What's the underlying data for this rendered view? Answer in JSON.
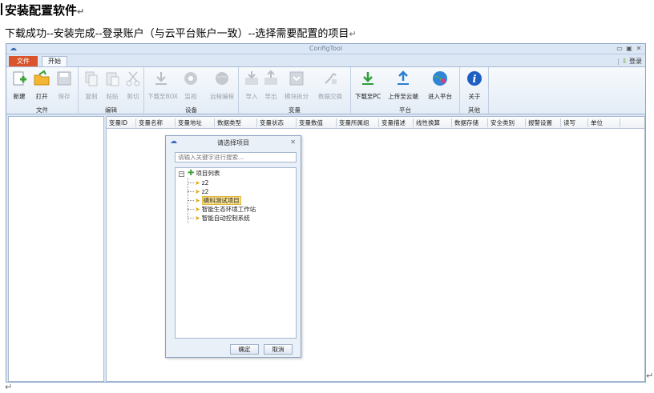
{
  "doc": {
    "heading": "安装配置软件",
    "subheading": "下载成功--安装完成--登录账户（与云平台账户一致）--选择需要配置的项目",
    "para_mark": "↵"
  },
  "window": {
    "title": "ConfigTool",
    "minimize": "▭",
    "maximize": "▣",
    "close": "✕"
  },
  "tabs": {
    "file": "文件",
    "start": "开始"
  },
  "login_label": "登录",
  "ribbon": {
    "groups": {
      "file": "文件",
      "edit": "编辑",
      "device": "设备",
      "variable": "变量",
      "platform": "平台",
      "other": "其他"
    },
    "buttons": {
      "new": "新建",
      "open": "打开",
      "save": "保存",
      "copy": "复制",
      "paste": "粘贴",
      "cut": "剪切",
      "download_box": "下载至BOX",
      "monitor": "监视",
      "remote_program": "远程编程",
      "import": "导入",
      "export": "导出",
      "module_split": "模块拆分",
      "data_exchange": "数据交换",
      "download_pc": "下载至PC",
      "upload_cloud": "上传至云端",
      "enter_platform": "进入平台",
      "about": "关于"
    }
  },
  "grid": {
    "columns": [
      "变量ID",
      "变量名称",
      "变量地址",
      "数据类型",
      "变量状态",
      "变量数值",
      "变量所属组",
      "变量描述",
      "线性换算",
      "数据存储",
      "安全类别",
      "报警设置",
      "读写",
      "单位"
    ]
  },
  "dialog": {
    "title": "请选择项目",
    "close": "✕",
    "search_placeholder": "请输入关键字进行搜索...",
    "tree_root": "项目列表",
    "items": [
      "z2",
      "z2",
      "磷科测试项目",
      "智能生态环境工作站",
      "智能自动控制系统"
    ],
    "ok": "确定",
    "cancel": "取消"
  }
}
